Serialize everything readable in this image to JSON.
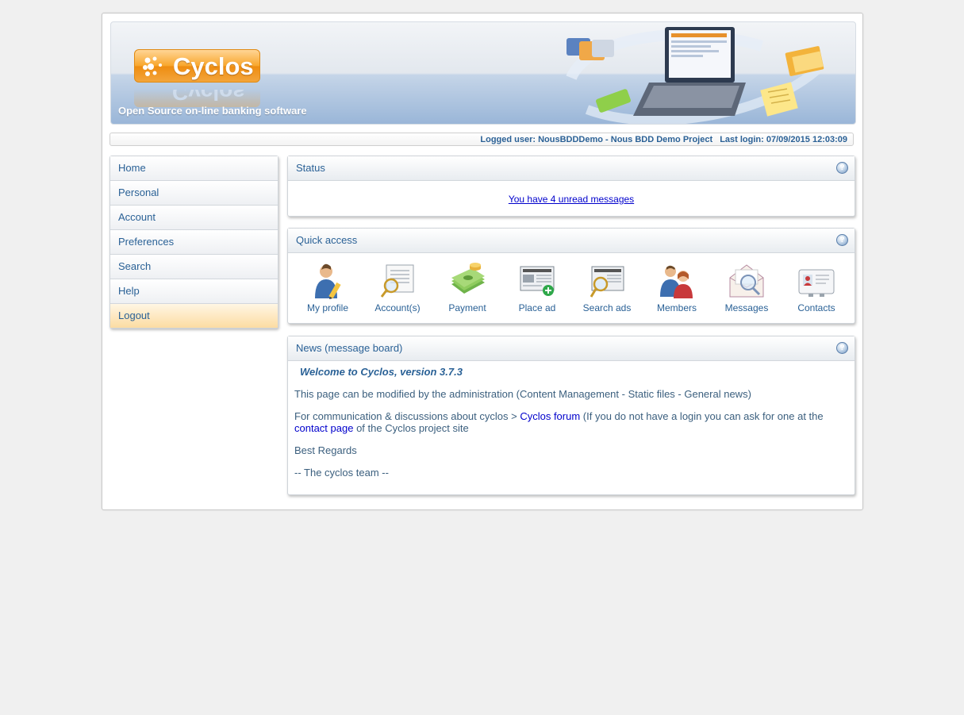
{
  "header": {
    "logo_text": "Cyclos",
    "tagline": "Open Source on-line banking software"
  },
  "userbar": {
    "logged_user": "Logged user: NousBDDDemo - Nous BDD Demo Project",
    "last_login": "Last login: 07/09/2015 12:03:09"
  },
  "menu": {
    "items": [
      "Home",
      "Personal",
      "Account",
      "Preferences",
      "Search",
      "Help",
      "Logout"
    ]
  },
  "status": {
    "title": "Status",
    "message": "You have 4 unread messages"
  },
  "quick_access": {
    "title": "Quick access",
    "items": [
      "My profile",
      "Account(s)",
      "Payment",
      "Place ad",
      "Search ads",
      "Members",
      "Messages",
      "Contacts"
    ],
    "icons": [
      "profile-icon",
      "accounts-icon",
      "payment-icon",
      "place-ad-icon",
      "search-ads-icon",
      "members-icon",
      "messages-icon",
      "contacts-icon"
    ]
  },
  "news": {
    "title": "News (message board)",
    "welcome": "Welcome to Cyclos, version 3.7.3",
    "para1": "This page can be modified by the administration (Content Management - Static files - General news)",
    "para2_prefix": "For communication & discussions about cyclos > ",
    "forum_link": "Cyclos forum",
    "para2_middle": " (If you do not have a login you can ask for one at the ",
    "contact_link": "contact page",
    "para2_suffix": " of the Cyclos project site",
    "regards": "Best Regards",
    "signature": "-- The cyclos team --"
  },
  "help_glyph": "?",
  "colors": {
    "link": "#2a6196",
    "accent_orange": "#f3a53c",
    "active_menu": "#fcdca2"
  }
}
